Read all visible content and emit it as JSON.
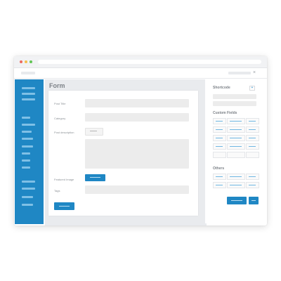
{
  "window": {
    "traffic_lights": [
      "red",
      "yellow",
      "green"
    ],
    "close_symbol": "×"
  },
  "sidebar": {
    "accent_color": "#1f87c4",
    "items": [
      {
        "icon": "nav-item"
      },
      {
        "icon": "nav-item"
      },
      {
        "icon": "nav-item"
      },
      {
        "icon": "nav-item"
      },
      {
        "icon": "nav-item"
      },
      {
        "icon": "nav-item"
      },
      {
        "icon": "nav-item"
      },
      {
        "icon": "nav-item"
      },
      {
        "icon": "nav-item"
      },
      {
        "icon": "nav-item"
      },
      {
        "icon": "nav-item"
      },
      {
        "icon": "nav-item"
      },
      {
        "icon": "nav-item"
      },
      {
        "icon": "nav-item"
      }
    ]
  },
  "form": {
    "title": "Form",
    "fields": {
      "post_title": "Post Title",
      "category": "Category",
      "post_description": "Post description",
      "featured_image": "Featured Image",
      "tags": "Tags"
    }
  },
  "shortcode": {
    "heading": "Shortcode",
    "plus_symbol": "+"
  },
  "custom_fields": {
    "heading": "Custom Fields"
  },
  "others": {
    "heading": "Others"
  },
  "colors": {
    "accent": "#1f87c4",
    "panel_bg": "#e9ebee"
  }
}
